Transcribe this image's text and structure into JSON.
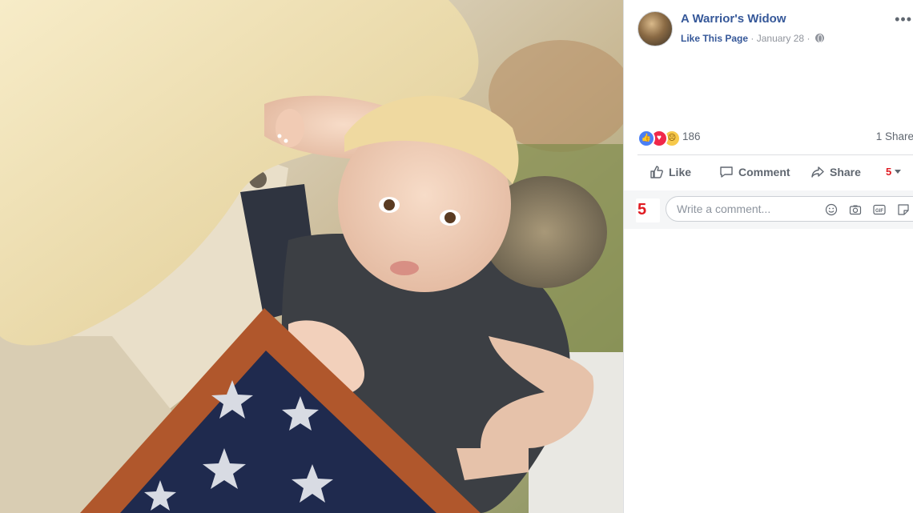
{
  "post": {
    "page_name": "A Warrior's Widow",
    "like_page": "Like This Page",
    "separator": "·",
    "date": "January 28",
    "more_glyph": "•••"
  },
  "engagement": {
    "reaction_count": "186",
    "shares": "1 Share",
    "reaction_icons": [
      "like-icon",
      "love-icon",
      "sad-icon"
    ]
  },
  "actions": {
    "like": "Like",
    "comment": "Comment",
    "share": "Share",
    "page_badge": "5"
  },
  "comment_box": {
    "placeholder": "Write a comment...",
    "avatar_text": "5"
  },
  "colors": {
    "link": "#365899",
    "meta": "#90949c",
    "action": "#606770",
    "brand_red": "#e01b22"
  }
}
